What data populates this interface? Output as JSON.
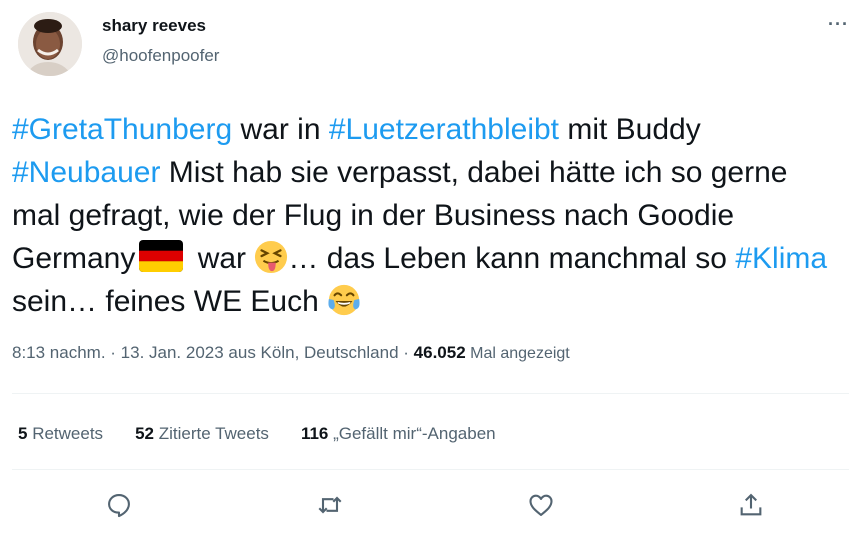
{
  "author": {
    "display_name": "shary reeves",
    "handle": "@hoofenpoofer",
    "avatar_icon": "profile-photo"
  },
  "more_icon": "more-horizontal-icon",
  "tweet": {
    "segments": {
      "s1": "#GretaThunberg",
      "s2": " war in ",
      "s3": "#Luetzerathbleibt",
      "s4": " mit Buddy ",
      "s5": "#Neubauer",
      "s6": " Mist hab sie verpasst, dabei hätte ich so gerne mal gefragt, wie der Flug in der Business nach Goodie Germany",
      "s7": " war ",
      "s8": "… das Leben kann manchmal so ",
      "s9": "#Klima",
      "s10": " sein… feines WE Euch "
    },
    "emojis": [
      "flag-germany-icon",
      "squinting-tongue-face-icon",
      "tears-of-joy-face-icon"
    ]
  },
  "meta": {
    "time": "8:13 nachm.",
    "sep1": " · ",
    "date": "13. Jan. 2023",
    "location": " aus Köln, Deutschland ",
    "sep2": "·",
    "views_count": " 46.052",
    "views_label": " Mal angezeigt"
  },
  "stats": {
    "retweets_count": "5",
    "retweets_label": " Retweets",
    "quotes_count": "52",
    "quotes_label": " Zitierte Tweets",
    "likes_count": "116",
    "likes_label": " „Gefällt mir“-Angaben"
  },
  "actions": [
    "reply-icon",
    "retweet-icon",
    "like-icon",
    "share-icon"
  ],
  "colors": {
    "link": "#1d9bf0",
    "secondary_text": "#536471",
    "primary_text": "#0f1419",
    "divider": "#eff3f4"
  }
}
